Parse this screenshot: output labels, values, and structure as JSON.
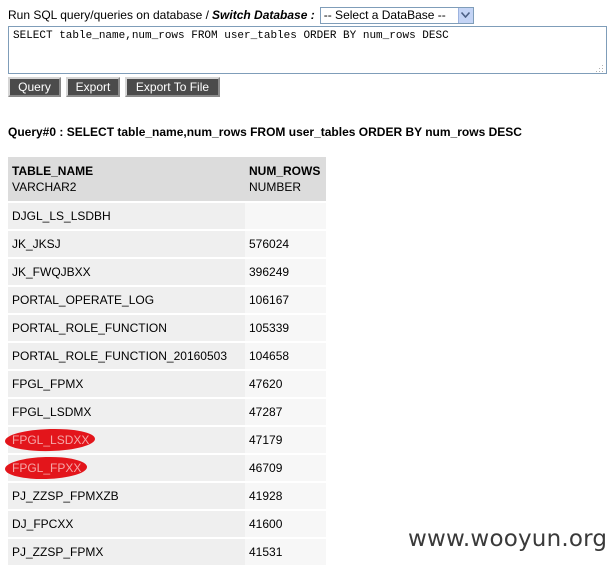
{
  "header": {
    "prompt": "Run SQL query/queries on database /",
    "switch_label": "Switch Database :",
    "select_value": "-- Select a DataBase --"
  },
  "sql_input": {
    "value": "SELECT table_name,num_rows FROM user_tables ORDER BY num_rows DESC"
  },
  "toolbar": {
    "query_label": "Query",
    "export_label": "Export",
    "export_file_label": "Export To File"
  },
  "result": {
    "title": "Query#0 : SELECT table_name,num_rows FROM user_tables ORDER BY num_rows DESC",
    "columns": [
      {
        "name": "TABLE_NAME",
        "type": "VARCHAR2"
      },
      {
        "name": "NUM_ROWS",
        "type": "NUMBER"
      }
    ],
    "rows": [
      {
        "table_name": "DJGL_LS_LSDBH",
        "num_rows": ""
      },
      {
        "table_name": "JK_JKSJ",
        "num_rows": "576024"
      },
      {
        "table_name": "JK_FWQJBXX",
        "num_rows": "396249"
      },
      {
        "table_name": "PORTAL_OPERATE_LOG",
        "num_rows": "106167"
      },
      {
        "table_name": "PORTAL_ROLE_FUNCTION",
        "num_rows": "105339"
      },
      {
        "table_name": "PORTAL_ROLE_FUNCTION_20160503",
        "num_rows": "104658"
      },
      {
        "table_name": "FPGL_FPMX",
        "num_rows": "47620"
      },
      {
        "table_name": "FPGL_LSDMX",
        "num_rows": "47287"
      },
      {
        "table_name": "FPGL_LSDXX",
        "num_rows": "47179"
      },
      {
        "table_name": "FPGL_FPXX",
        "num_rows": "46709"
      },
      {
        "table_name": "PJ_ZZSP_FPMXZB",
        "num_rows": "41928"
      },
      {
        "table_name": "DJ_FPCXX",
        "num_rows": "41600"
      },
      {
        "table_name": "PJ_ZZSP_FPMX",
        "num_rows": "41531"
      }
    ]
  },
  "watermark": "www.wooyun.org",
  "colors": {
    "header_bg": "#dcdcdc",
    "cell_bg": "#efefef",
    "button_bg": "#4b4b4b",
    "highlight": "#e3151b"
  }
}
